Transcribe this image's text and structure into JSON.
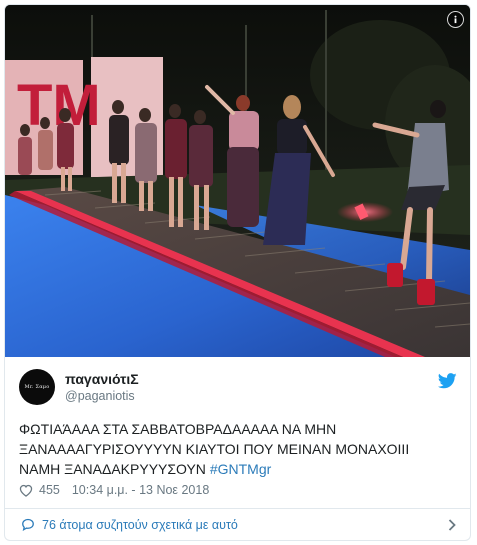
{
  "tweet": {
    "display_name": "παγανιότιΣ",
    "handle": "@paganiotis",
    "avatar_text": "Mr. Σαμο",
    "text_before_hashtag": "ΦΩΤΙΑΆΑΑΑ ΣΤΑ ΣΑΒΒΑΤΟΒΡΑΔΑΑΑΑΑ ΝΑ ΜΗΝ\nΞΑΝΑΑΑΑΓΥΡΙΣΟΥΥΥΥΝ ΚΙΑΥΤΟΙ ΠΟΥ ΜΕΙΝΑΝ ΜΟΝΑΧΟΙΙΙ\nΝΑΜΗ ΞΑΝΑΔΑΚΡΥΥΥΣΟΥΝ ",
    "hashtag": "#GNTMgr",
    "likes": "455",
    "timestamp": "10:34 μ.μ. - 13 Νοε 2018",
    "conversation": "76 άτομα συζητούν σχετικά με αυτό"
  },
  "photo": {
    "sign_text": "TM",
    "icons": {
      "info": "info-icon",
      "brand": "twitter-bird-icon",
      "like": "heart-icon",
      "reply": "speech-bubble-icon",
      "more": "chevron-right-icon"
    }
  },
  "colors": {
    "link": "#2b7bb9",
    "muted": "#697882",
    "text": "#1c2022",
    "border": "#e1e8ed",
    "pool": "#2f6fd8",
    "runway_glow": "#e8334f"
  }
}
